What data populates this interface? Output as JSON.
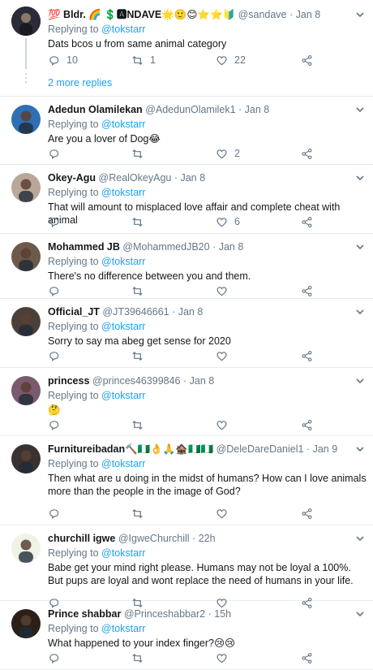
{
  "thread_top": {
    "name": "💯 Bldr. 🌈 💲🅰NDAVE🌟🙂😊⭐⭐🔰",
    "handle": "@sandave",
    "date": "Jan 8",
    "reply_to_label": "Replying to",
    "reply_to": "@tokstarr",
    "text": "Dats bcos u from same animal category",
    "replies": "10",
    "retweets": "1",
    "likes": "22"
  },
  "more_replies": "2 more replies",
  "tweets": [
    {
      "name": "Adedun Olamilekan",
      "handle": "@AdedunOlamilek1",
      "date": "Jan 8",
      "reply_to_label": "Replying to",
      "reply_to": "@tokstarr",
      "text": "Are you a lover of Dog😂",
      "replies": "",
      "retweets": "",
      "likes": "2",
      "avatar_color": "#2f6fb4"
    },
    {
      "name": "Okey-Agu",
      "handle": "@RealOkeyAgu",
      "date": "Jan 8",
      "reply_to_label": "Replying to",
      "reply_to": "@tokstarr",
      "text": "That will amount to misplaced love affair and complete cheat with animal",
      "replies": "",
      "retweets": "",
      "likes": "6",
      "avatar_color": "#b9a79a"
    },
    {
      "name": "Mohammed JB",
      "handle": "@MohammedJB20",
      "date": "Jan 8",
      "reply_to_label": "Replying to",
      "reply_to": "@tokstarr",
      "text": "There's no difference between you and them.",
      "replies": "",
      "retweets": "",
      "likes": "",
      "avatar_color": "#6d5a4a"
    },
    {
      "name": "Official_JT",
      "handle": "@JT39646661",
      "date": "Jan 8",
      "reply_to_label": "Replying to",
      "reply_to": "@tokstarr",
      "text": "Sorry to say ma abeg get sense for 2020",
      "replies": "",
      "retweets": "",
      "likes": "",
      "avatar_color": "#4a4038"
    },
    {
      "name": "princess",
      "handle": "@princes46399846",
      "date": "Jan 8",
      "reply_to_label": "Replying to",
      "reply_to": "@tokstarr",
      "text": "🤔",
      "replies": "",
      "retweets": "",
      "likes": "",
      "avatar_color": "#7a5a6e"
    },
    {
      "name": "Furnitureibadan🔨🇳🇬👌🙏🏚️🇳🇬🇳🇬",
      "handle": "@DeleDareDaniel1",
      "date": "Jan 9",
      "reply_to_label": "Replying to",
      "reply_to": "@tokstarr",
      "text": "Then what are u doing in the midst of humans? How can I love animals more than the people in the image of God?",
      "replies": "",
      "retweets": "",
      "likes": "",
      "avatar_color": "#3a3230"
    },
    {
      "name": "churchill igwe",
      "handle": "@IgweChurchill",
      "date": "22h",
      "reply_to_label": "Replying to",
      "reply_to": "@tokstarr",
      "text": "Babe get your mind right please. Humans may not be loyal a 100%. But pups are loyal and wont replace the need of humans in your life.",
      "replies": "",
      "retweets": "",
      "likes": "",
      "avatar_color": "#eef3e6"
    },
    {
      "name": "Prince shabbar",
      "handle": "@Princeshabbar2",
      "date": "15h",
      "reply_to_label": "Replying to",
      "reply_to": "@tokstarr",
      "text": "What happened to your index finger?😢😢",
      "replies": "",
      "retweets": "",
      "likes": "",
      "avatar_color": "#2a2018"
    }
  ],
  "colors": {
    "link": "#1da1f2",
    "muted": "#657786",
    "text": "#14171a",
    "divider": "#e6ecf0"
  },
  "icons": [
    "reply-icon",
    "retweet-icon",
    "like-icon",
    "share-icon",
    "chevron-down-icon"
  ]
}
